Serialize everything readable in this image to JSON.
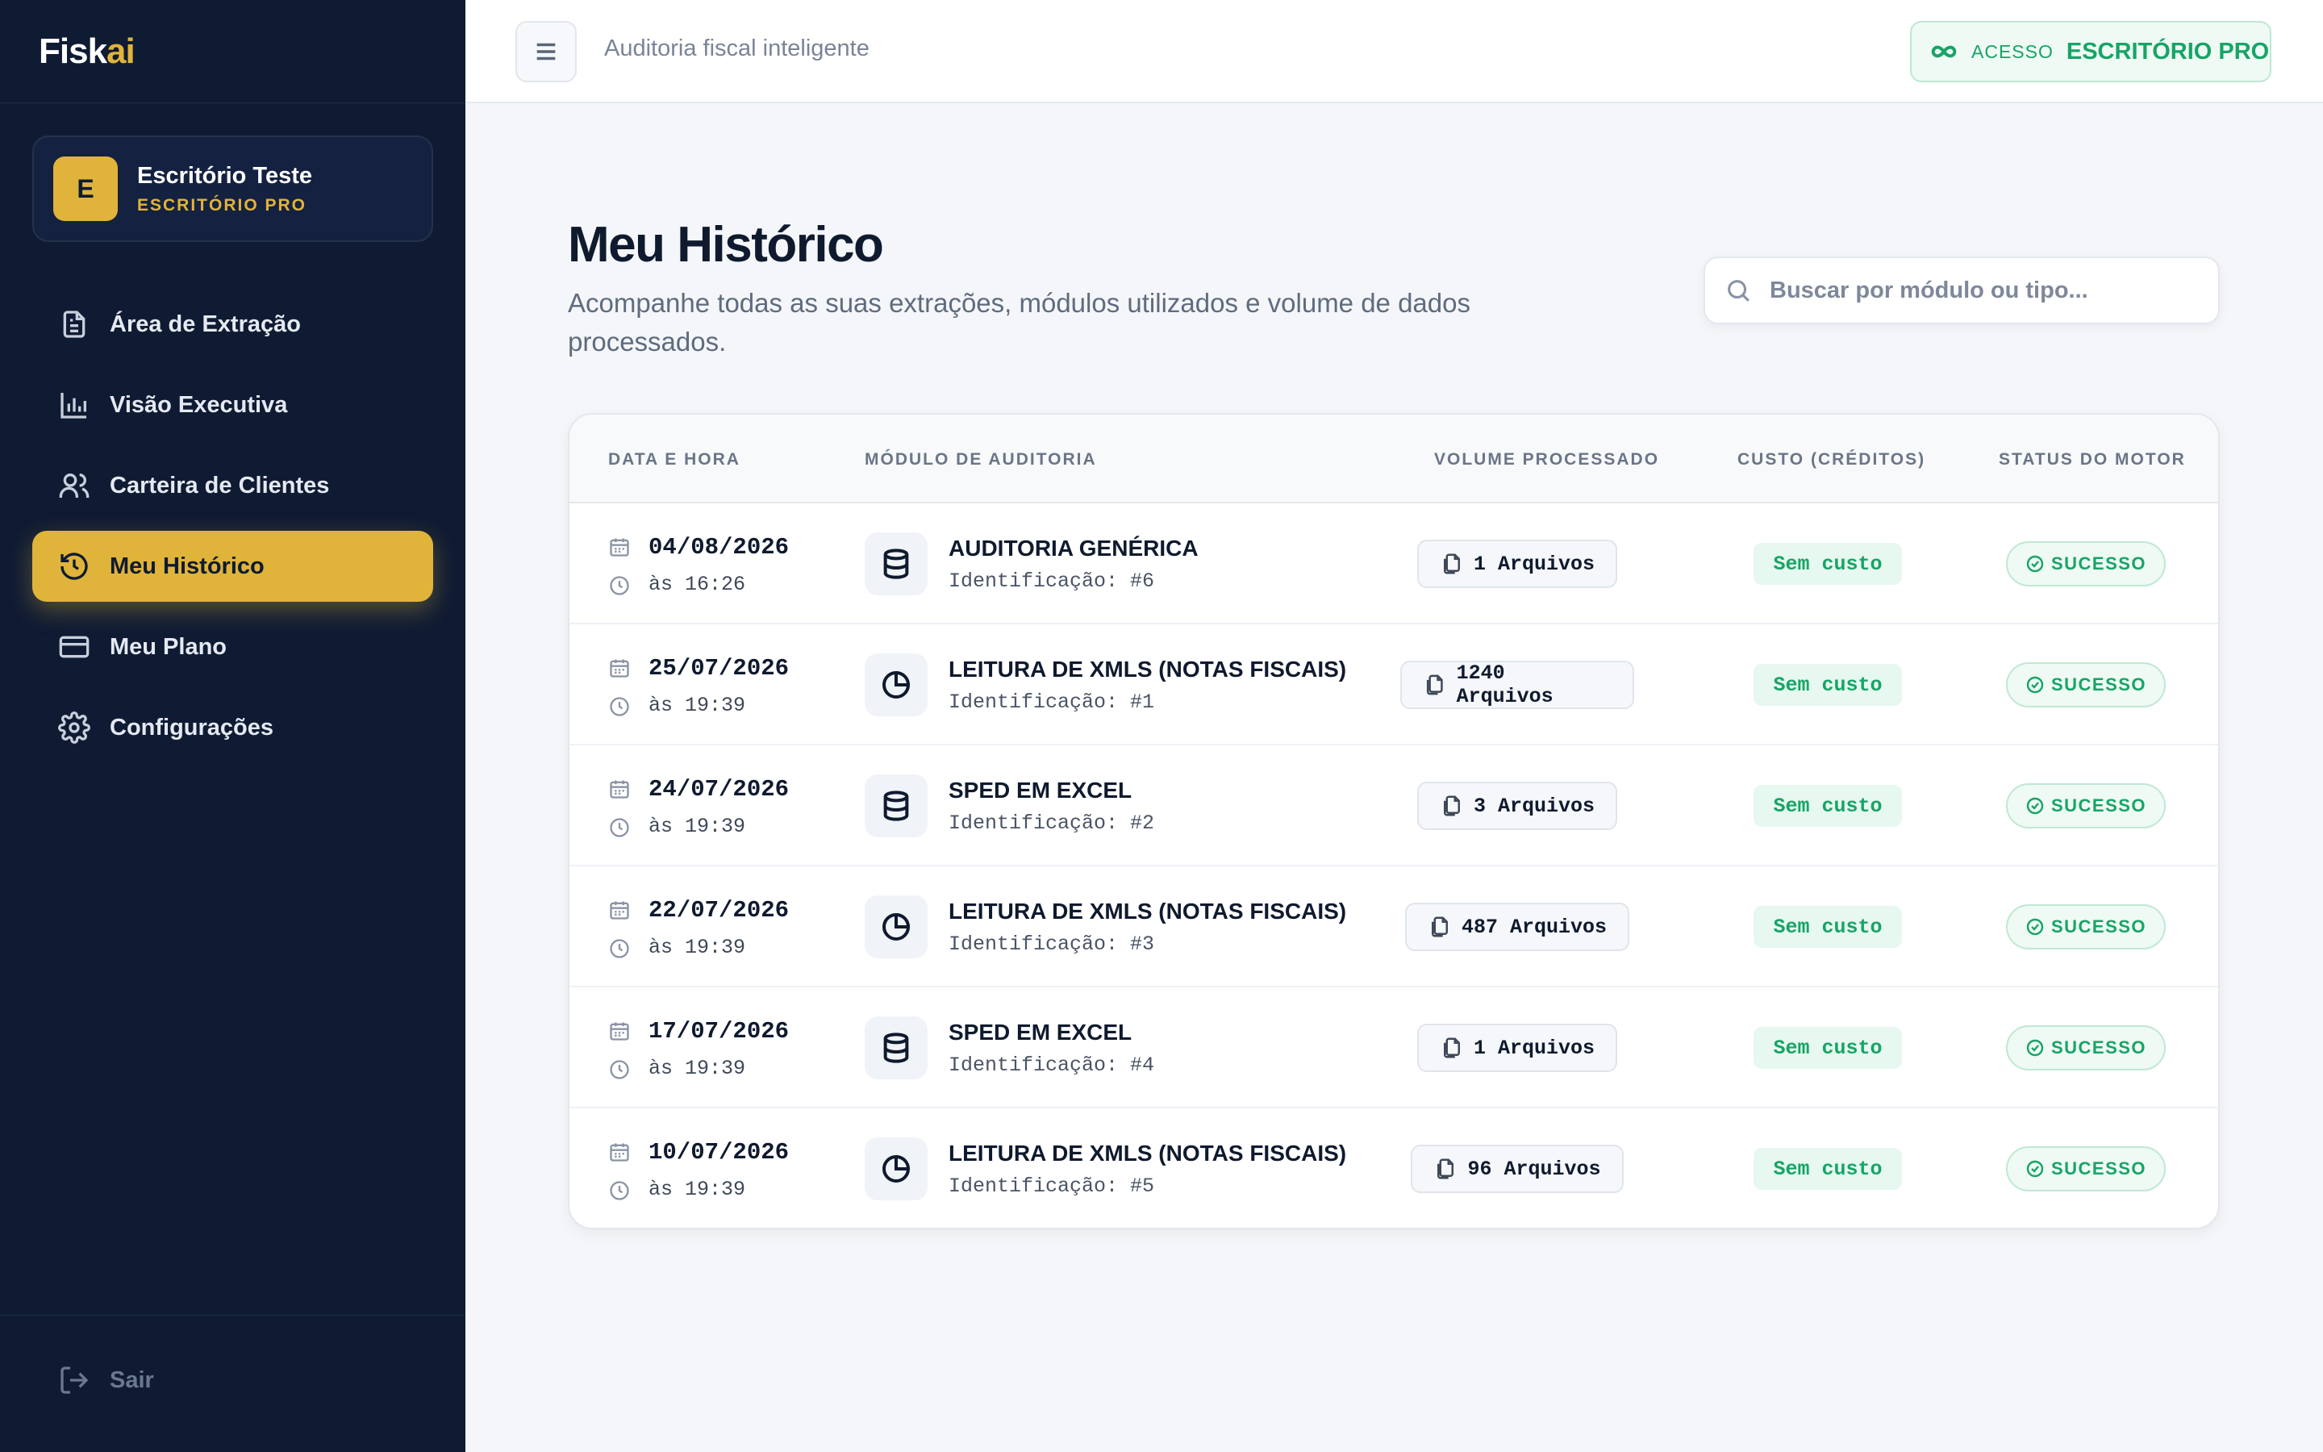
{
  "brand": {
    "logo_main": "Fisk",
    "logo_accent": "ai"
  },
  "account": {
    "initial": "E",
    "name": "Escritório Teste",
    "plan": "ESCRITÓRIO PRO"
  },
  "nav": [
    {
      "label": "Área de Extração",
      "icon": "document-icon"
    },
    {
      "label": "Visão Executiva",
      "icon": "bar-chart-icon"
    },
    {
      "label": "Carteira de Clientes",
      "icon": "users-icon"
    },
    {
      "label": "Meu Histórico",
      "icon": "history-icon",
      "active": true
    },
    {
      "label": "Meu Plano",
      "icon": "credit-card-icon"
    },
    {
      "label": "Configurações",
      "icon": "gear-icon"
    }
  ],
  "logout_label": "Sair",
  "topbar": {
    "subtitle": "Auditoria fiscal inteligente",
    "access_label": "ACESSO",
    "access_value": "ESCRITÓRIO PRO"
  },
  "page": {
    "title": "Meu Histórico",
    "description": "Acompanhe todas as suas extrações, módulos utilizados e volume de dados processados."
  },
  "search": {
    "placeholder": "Buscar por módulo ou tipo...",
    "value": ""
  },
  "table": {
    "headers": {
      "date": "DATA E HORA",
      "module": "MÓDULO DE AUDITORIA",
      "volume": "VOLUME PROCESSADO",
      "cost": "CUSTO (CRÉDITOS)",
      "status": "STATUS DO MOTOR"
    },
    "rows": [
      {
        "date": "04/08/2026",
        "time": "às 16:26",
        "module": "AUDITORIA GENÉRICA",
        "id": "Identificação: #6",
        "icon": "database-icon",
        "volume": "1 Arquivos",
        "cost": "Sem custo",
        "status": "SUCESSO"
      },
      {
        "date": "25/07/2026",
        "time": "às 19:39",
        "module": "LEITURA DE XMLS (NOTAS FISCAIS)",
        "id": "Identificação: #1",
        "icon": "pie-chart-icon",
        "volume": "1240 Arquivos",
        "cost": "Sem custo",
        "status": "SUCESSO"
      },
      {
        "date": "24/07/2026",
        "time": "às 19:39",
        "module": "SPED EM EXCEL",
        "id": "Identificação: #2",
        "icon": "database-icon",
        "volume": "3 Arquivos",
        "cost": "Sem custo",
        "status": "SUCESSO"
      },
      {
        "date": "22/07/2026",
        "time": "às 19:39",
        "module": "LEITURA DE XMLS (NOTAS FISCAIS)",
        "id": "Identificação: #3",
        "icon": "pie-chart-icon",
        "volume": "487 Arquivos",
        "cost": "Sem custo",
        "status": "SUCESSO"
      },
      {
        "date": "17/07/2026",
        "time": "às 19:39",
        "module": "SPED EM EXCEL",
        "id": "Identificação: #4",
        "icon": "database-icon",
        "volume": "1 Arquivos",
        "cost": "Sem custo",
        "status": "SUCESSO"
      },
      {
        "date": "10/07/2026",
        "time": "às 19:39",
        "module": "LEITURA DE XMLS (NOTAS FISCAIS)",
        "id": "Identificação: #5",
        "icon": "pie-chart-icon",
        "volume": "96 Arquivos",
        "cost": "Sem custo",
        "status": "SUCESSO"
      }
    ]
  },
  "colors": {
    "sidebar_bg": "#0f1b33",
    "accent": "#e0b43a",
    "success": "#17a466",
    "page_bg": "#f4f6f9"
  }
}
